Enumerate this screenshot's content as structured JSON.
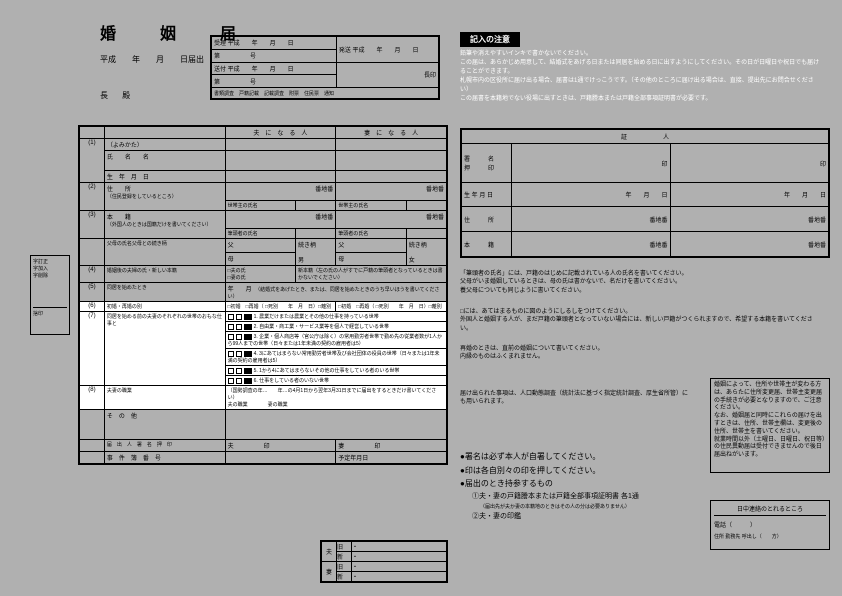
{
  "title": "婚　姻　届",
  "subtitle": "平成　　年　　月　　日届出",
  "chouDono": "長 殿",
  "receipt": {
    "r1c1": "受理 平成　　年　　月　　日",
    "r1c2": "発送 平成　　年　　月　　日",
    "r2c1": "第　　　　　号",
    "r3c1": "送付 平成　　年　　月　　日",
    "r3c2": "長印",
    "r4c1": "第　　　　　号",
    "r5": "書類調査　戸籍記載　記載調査　附票　住民票　通知"
  },
  "form": {
    "husband": "夫　に　な　る　人",
    "wife": "妻　に　な　る　人",
    "furigana": "（よみかた）",
    "name": "氏　　名　　名",
    "birth": "生　年　月　日",
    "row1": "(1)",
    "row2": "(2)",
    "address": "住　　所",
    "addressNote": "（住民登録をしているところ）",
    "head": "世帯主の氏名",
    "banchi": "番地番",
    "row3": "(3)",
    "honseki": "本　　籍",
    "honsekiNote": "（外国人のときは国籍だけを書いてください）",
    "hittousha": "筆頭者の氏名",
    "parents": "父母の氏名父母との続き柄",
    "father": "父",
    "mother": "母",
    "tsuzuki": "続き柄",
    "otoko": "男",
    "onna": "女",
    "row4": "(4)",
    "newHon": "婚姻後の夫婦の氏・新しい本籍",
    "newHonHead": "新本籍（左の氏の人がすでに戸籍の筆頭者となっているときは書かないでください）",
    "husbandShi": "□夫の氏",
    "wifeShi": "□妻の氏",
    "row5": "(5)",
    "doukyо": "同居を始めたとき",
    "doukyоDate": "年　　月",
    "doukyоNote": "（結婚式をあげたとき、または、同居を始めたときのうち早いほうを書いてください）",
    "row6": "(6)",
    "saikon": "初婚・再婚の別",
    "saikonH": "□初婚　□再婚（ □死別　　年　月　日）□離別",
    "saikonW": "□初婚　□再婚（ □死別　　年　月　日）□離別",
    "row7": "(7)",
    "doukyoBefore": "同居を始める前の夫妻のそれぞれの世帯のおもな仕事と",
    "work1": "1. 農業だけまたは農業とその他の仕事を持っている世帯",
    "work2": "2. 自由業・商工業・サービス業等を個人で経営している世帯",
    "work3": "3. 企業・個人商店等（官公庁は除く）の常用勤労者世帯で勤め先の従業者数が1人から99人までの世帯（日々または1年未満の契約の雇用者は5）",
    "work4": "4. 3にあてはまらない常用勤労者世帯及び会社団体の役員の世帯（日々または1年未満の契約の雇用者は5）",
    "work5": "5. 1から4にあてはまらないその他の仕事をしている者のいる世帯",
    "work6": "6. 仕事をしている者のいない世帯",
    "row8": "(8)",
    "shokugyou": "夫妻の職業",
    "shokugyouNote": "（国勢調査の年…　　年…の4月1日から翌年3月31日までに届出をするときだけ書いてください）",
    "husbandJob": "夫の職業",
    "wifeJob": "妻の職業",
    "sonota": "そ　の　他",
    "todoke": "届　出　人　署　名　押　印",
    "husband2": "夫",
    "wife2": "妻",
    "in": "印",
    "jiken": "事　件　簿　番　号",
    "yotei": "予定年月日"
  },
  "sideBox": {
    "l1": "字訂正",
    "l2": "字加入",
    "l3": "字削除",
    "l4": "捨印"
  },
  "notesTitle": "記入の注意",
  "notes": {
    "n1": "鉛筆や消えやすいインキで書かないでください。",
    "n2": "この届は、あらかじめ用意して、結婚式をあげる日または同居を始める日に出すようにしてください。その日が日曜日や祝日でも届けることができます。",
    "n3": "札幌市内の区役所に届け出る場合、届書は1通でけっこうです。（その他のところに届け出る場合は、直接、提出先にお問合せください）",
    "n4": "この届書を本籍地でない役場に出すときは、戸籍謄本または戸籍全部事項証明書が必要です。"
  },
  "witness": {
    "header": "証　　　　　　人",
    "shomei": "署　　　名",
    "ouin": "押　　　印",
    "in": "印",
    "birth": "生 年 月 日",
    "ymd": "年　　月　　日",
    "address": "住　　　所",
    "banchi": "番地番",
    "honseki": "本　　　籍"
  },
  "guides": {
    "g1": "「筆頭者の氏名」には、戸籍のはじめに記載されている人の氏名を書いてください。",
    "g2": "父母がいま婚姻しているときは、母の氏は書かないで、名だけを書いてください。",
    "g3": "養父母についても同じように書いてください。",
    "g4": "□には、あてはまるものに図のようにしるしをつけてください。",
    "g5": "外国人と婚姻する人が、まだ戸籍の筆頭者となっていない場合には、新しい戸籍がつくられますので、希望する本籍を書いてください。",
    "g6": "再婚のときは、直前の婚姻について書いてください。",
    "g7": "内縁のものはふくまれません。",
    "g8": "届け出られた事項は、人口動態調査（統計法に基づく指定統計調査、厚生省所管）にも用いられます。"
  },
  "bullets": {
    "b1": "●署名は必ず本人が自署してください。",
    "b2": "●印は各自別々の印を押してください。",
    "b3": "●届出のとき持参するもの",
    "b3a": "①夫・妻の戸籍謄本または戸籍全部事項証明書 各1通",
    "b3aNote": "（届出先が夫か妻の本籍地のときはその人の分は必要ありません）",
    "b3b": "②夫・妻の印鑑"
  },
  "infoRight": {
    "p1": "婚姻によって、住所や世帯主が変わる方は、あらたに住所変更届、世帯主変更届の手続きが必要となりますので、ご注意ください。",
    "p2": "なお、婚姻届と同時にこれらの届けを出すときは、住所、世帯主欄は、変更後の住所、世帯主を書いてください。",
    "p3": "就業時間以外（土曜日、日曜日、祝日等）の住民異動届は受付できませんので後日届出ねがいます。"
  },
  "contact": {
    "title": "日中連絡のとれるところ",
    "tel": "電話（　　　）",
    "addr": "住所 勤務先 呼出し（　　方）"
  },
  "bottomTable": {
    "husband": "夫",
    "wife": "妻",
    "old": "旧",
    "new": "新"
  }
}
